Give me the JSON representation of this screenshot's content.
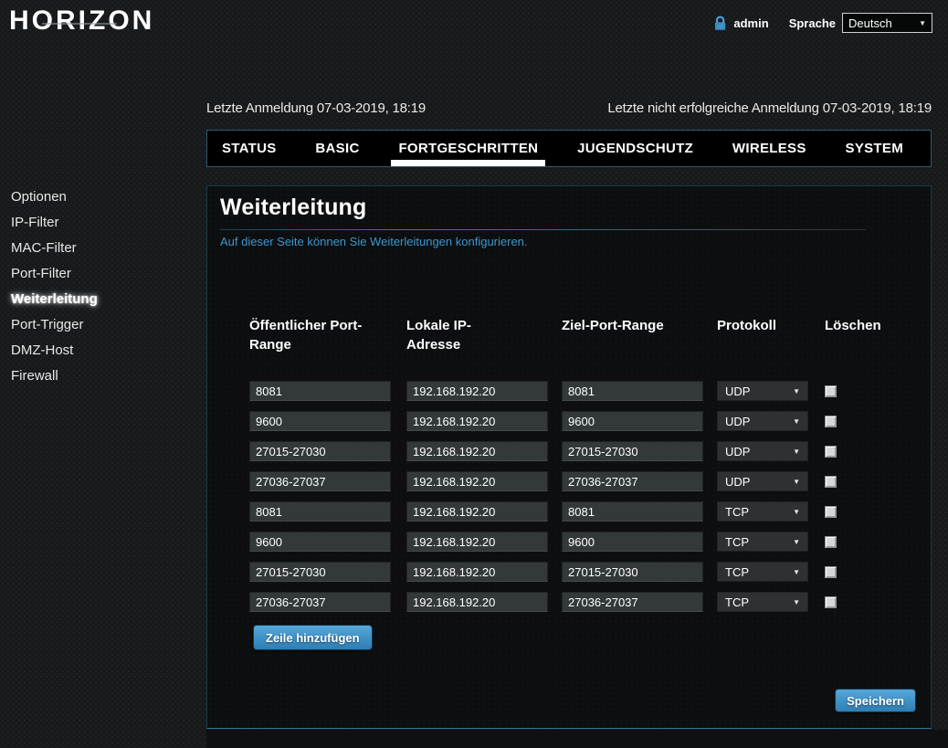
{
  "header": {
    "logo": "HORIZON",
    "username": "admin",
    "language_label": "Sprache",
    "language_value": "Deutsch"
  },
  "login_info": {
    "last_login": "Letzte Anmeldung 07-03-2019, 18:19",
    "last_failed": "Letzte nicht erfolgreiche Anmeldung 07-03-2019, 18:19"
  },
  "tabs": [
    {
      "label": "STATUS",
      "active": false
    },
    {
      "label": "BASIC",
      "active": false
    },
    {
      "label": "FORTGESCHRITTEN",
      "active": true
    },
    {
      "label": "JUGENDSCHUTZ",
      "active": false
    },
    {
      "label": "WIRELESS",
      "active": false
    },
    {
      "label": "SYSTEM",
      "active": false
    }
  ],
  "sidebar": [
    {
      "label": "Optionen",
      "active": false
    },
    {
      "label": "IP-Filter",
      "active": false
    },
    {
      "label": "MAC-Filter",
      "active": false
    },
    {
      "label": "Port-Filter",
      "active": false
    },
    {
      "label": "Weiterleitung",
      "active": true
    },
    {
      "label": "Port-Trigger",
      "active": false
    },
    {
      "label": "DMZ-Host",
      "active": false
    },
    {
      "label": "Firewall",
      "active": false
    }
  ],
  "panel": {
    "title": "Weiterleitung",
    "description": "Auf dieser Seite können Sie Weiterleitungen konfigurieren.",
    "columns": [
      "Öffentlicher Port-Range",
      "Lokale IP-Adresse",
      "Ziel-Port-Range",
      "Protokoll",
      "Löschen"
    ],
    "rows": [
      {
        "public_range": "8081",
        "local_ip": "192.168.192.20",
        "target_range": "8081",
        "protocol": "UDP",
        "delete_checked": false
      },
      {
        "public_range": "9600",
        "local_ip": "192.168.192.20",
        "target_range": "9600",
        "protocol": "UDP",
        "delete_checked": false
      },
      {
        "public_range": "27015-27030",
        "local_ip": "192.168.192.20",
        "target_range": "27015-27030",
        "protocol": "UDP",
        "delete_checked": false
      },
      {
        "public_range": "27036-27037",
        "local_ip": "192.168.192.20",
        "target_range": "27036-27037",
        "protocol": "UDP",
        "delete_checked": false
      },
      {
        "public_range": "8081",
        "local_ip": "192.168.192.20",
        "target_range": "8081",
        "protocol": "TCP",
        "delete_checked": false
      },
      {
        "public_range": "9600",
        "local_ip": "192.168.192.20",
        "target_range": "9600",
        "protocol": "TCP",
        "delete_checked": false
      },
      {
        "public_range": "27015-27030",
        "local_ip": "192.168.192.20",
        "target_range": "27015-27030",
        "protocol": "TCP",
        "delete_checked": false
      },
      {
        "public_range": "27036-27037",
        "local_ip": "192.168.192.20",
        "target_range": "27036-27037",
        "protocol": "TCP",
        "delete_checked": false
      }
    ],
    "add_row_label": "Zeile hinzufügen",
    "save_label": "Speichern"
  },
  "colors": {
    "accent_blue": "#3e96cc",
    "button_blue": "#3c92c8",
    "panel_border": "#1e4a5c",
    "active_underline": "#ffffff"
  }
}
